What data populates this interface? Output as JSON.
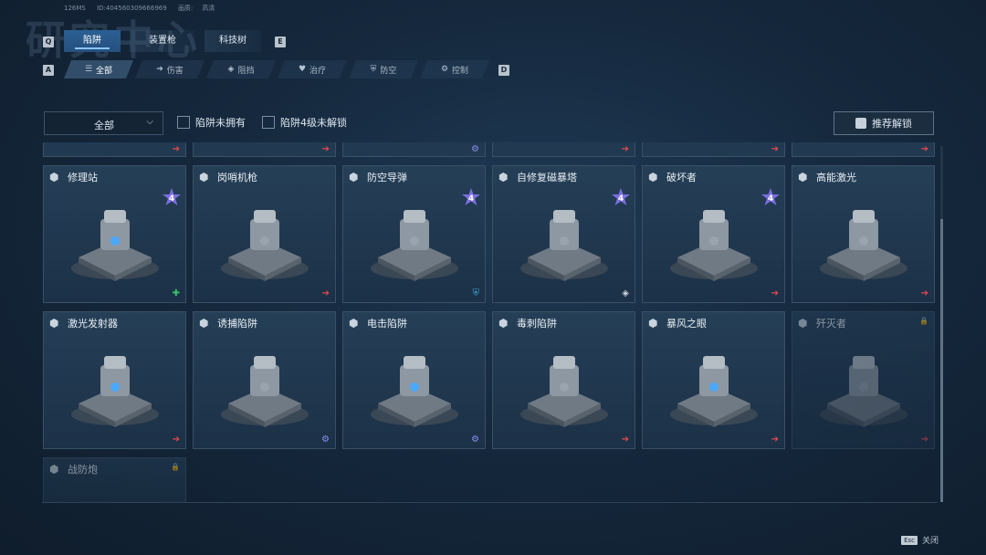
{
  "header": {
    "bg_title": "研究中心",
    "ping": "126MS",
    "uid": "ID:404560309666969",
    "quality_label": "画质:",
    "quality": "高清"
  },
  "keys": {
    "prev_tab": "Q",
    "next_tab": "E",
    "prev_filter": "A",
    "next_filter": "D"
  },
  "tabs": [
    {
      "label": "陷阱",
      "active": true
    },
    {
      "label": "装置枪",
      "active": false
    },
    {
      "label": "科技树",
      "active": false
    }
  ],
  "filters": [
    {
      "label": "全部",
      "icon": "list-icon",
      "glyph": "☰",
      "active": true
    },
    {
      "label": "伤害",
      "icon": "arrow-icon",
      "glyph": "➔"
    },
    {
      "label": "阻挡",
      "icon": "shield-icon",
      "glyph": "◈"
    },
    {
      "label": "治疗",
      "icon": "heart-icon",
      "glyph": "♥"
    },
    {
      "label": "防空",
      "icon": "air-shield-icon",
      "glyph": "⛨"
    },
    {
      "label": "控制",
      "icon": "gear-icon",
      "glyph": "⚙"
    }
  ],
  "toolbar": {
    "dropdown_value": "全部",
    "check1": "陷阱未拥有",
    "check2": "陷阱4级未解锁",
    "recommend": "推荐解锁"
  },
  "cards": [
    {
      "name": "修理站",
      "level": "4",
      "corner": "heal",
      "corner_glyph": "✚",
      "corner_color": "#37c26a"
    },
    {
      "name": "岗哨机枪",
      "level": "",
      "corner": "arrow",
      "corner_glyph": "➔",
      "corner_color": "#e5484d"
    },
    {
      "name": "防空导弹",
      "level": "4",
      "corner": "air",
      "corner_glyph": "⛨",
      "corner_color": "#3ca5d8"
    },
    {
      "name": "自修复磁暴塔",
      "level": "4",
      "corner": "block",
      "corner_glyph": "◈",
      "corner_color": "#d0d6dc"
    },
    {
      "name": "破坏者",
      "level": "4",
      "corner": "arrow",
      "corner_glyph": "➔",
      "corner_color": "#e5484d"
    },
    {
      "name": "高能激光",
      "level": "",
      "corner": "arrow",
      "corner_glyph": "➔",
      "corner_color": "#e5484d"
    },
    {
      "name": "激光发射器",
      "level": "",
      "corner": "arrow",
      "corner_glyph": "➔",
      "corner_color": "#e5484d"
    },
    {
      "name": "诱捕陷阱",
      "level": "",
      "corner": "control",
      "corner_glyph": "⚙",
      "corner_color": "#8c8cf2"
    },
    {
      "name": "电击陷阱",
      "level": "",
      "corner": "control",
      "corner_glyph": "⚙",
      "corner_color": "#8c8cf2"
    },
    {
      "name": "毒刺陷阱",
      "level": "",
      "corner": "arrow",
      "corner_glyph": "➔",
      "corner_color": "#e5484d"
    },
    {
      "name": "暴风之眼",
      "level": "",
      "corner": "arrow",
      "corner_glyph": "➔",
      "corner_color": "#e5484d"
    },
    {
      "name": "歼灭者",
      "level": "",
      "corner": "arrow",
      "corner_glyph": "➔",
      "corner_color": "#e5484d",
      "locked": true
    },
    {
      "name": "战防炮",
      "level": "",
      "corner": "",
      "corner_glyph": "",
      "corner_color": "",
      "locked": true
    }
  ],
  "top_partial": [
    {
      "corner_glyph": "➔",
      "corner_color": "#e5484d"
    },
    {
      "corner_glyph": "➔",
      "corner_color": "#e5484d"
    },
    {
      "corner_glyph": "⚙",
      "corner_color": "#8c8cf2"
    },
    {
      "corner_glyph": "➔",
      "corner_color": "#e5484d"
    },
    {
      "corner_glyph": "➔",
      "corner_color": "#e5484d"
    },
    {
      "corner_glyph": "➔",
      "corner_color": "#e5484d"
    }
  ],
  "footer": {
    "esc_key": "Esc",
    "close_label": "关闭"
  }
}
